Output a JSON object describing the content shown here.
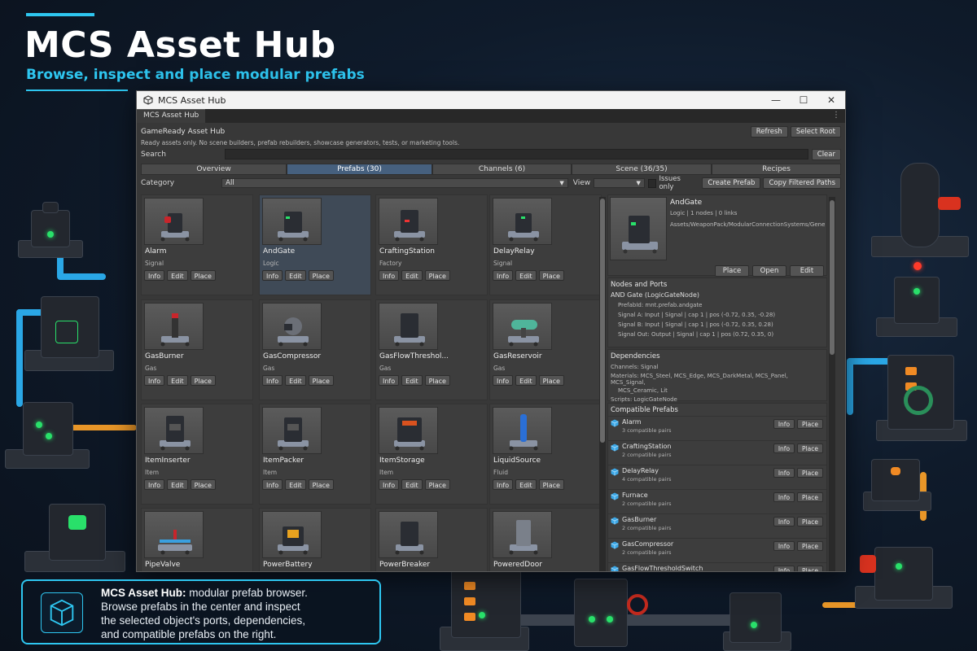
{
  "poster": {
    "title": "MCS Asset Hub",
    "subtitle": "Browse, inspect and place modular prefabs",
    "callout_bold": "MCS Asset Hub:",
    "callout_line1": " modular prefab browser.",
    "callout_line2": "Browse prefabs in the center and inspect",
    "callout_line3": "the selected object's ports, dependencies,",
    "callout_line4": "and compatible prefabs on the right."
  },
  "window": {
    "title": "MCS Asset Hub",
    "tab": "MCS Asset Hub",
    "minimize": "—",
    "maximize": "☐",
    "close": "✕"
  },
  "header": {
    "title": "GameReady Asset Hub",
    "refresh": "Refresh",
    "select_root": "Select Root",
    "note": "Ready assets only. No scene builders, prefab rebuilders, showcase generators, tests, or marketing tools."
  },
  "search": {
    "label": "Search",
    "value": "",
    "clear": "Clear"
  },
  "tabs": [
    "Overview",
    "Prefabs (30)",
    "Channels (6)",
    "Scene (36/35)",
    "Recipes"
  ],
  "filter": {
    "category_label": "Category",
    "category_value": "All",
    "view_label": "View",
    "view_value": "",
    "issues_only": "Issues only",
    "create_prefab": "Create Prefab",
    "copy_paths": "Copy Filtered Paths"
  },
  "card_actions": {
    "info": "Info",
    "edit": "Edit",
    "place": "Place"
  },
  "prefabs": [
    {
      "name": "Alarm",
      "category": "Signal"
    },
    {
      "name": "AndGate",
      "category": "Logic"
    },
    {
      "name": "CraftingStation",
      "category": "Factory"
    },
    {
      "name": "DelayRelay",
      "category": "Signal"
    },
    {
      "name": "GasBurner",
      "category": "Gas"
    },
    {
      "name": "GasCompressor",
      "category": "Gas"
    },
    {
      "name": "GasFlowThreshol...",
      "category": "Gas"
    },
    {
      "name": "GasReservoir",
      "category": "Gas"
    },
    {
      "name": "ItemInserter",
      "category": "Item"
    },
    {
      "name": "ItemPacker",
      "category": "Item"
    },
    {
      "name": "ItemStorage",
      "category": "Item"
    },
    {
      "name": "LiquidSource",
      "category": "Fluid"
    },
    {
      "name": "PipeValve",
      "category": ""
    },
    {
      "name": "PowerBattery",
      "category": ""
    },
    {
      "name": "PowerBreaker",
      "category": ""
    },
    {
      "name": "PoweredDoor",
      "category": ""
    }
  ],
  "detail": {
    "name": "AndGate",
    "meta": "Logic | 1 nodes | 0 links",
    "path": "Assets/WeaponPack/ModularConnectionSystems/Generated/Pr",
    "place": "Place",
    "open": "Open",
    "edit": "Edit"
  },
  "nodes": {
    "header": "Nodes and Ports",
    "node": "AND Gate (LogicGateNode)",
    "prefab_id": "PrefabId: mnt.prefab.andgate",
    "port_a": "Signal A: Input | Signal | cap 1 | pos (-0.72, 0.35, -0.28)",
    "port_b": "Signal B: Input | Signal | cap 1 | pos (-0.72, 0.35, 0.28)",
    "port_out": "Signal Out: Output | Signal | cap 1 | pos (0.72, 0.35, 0)"
  },
  "deps": {
    "header": "Dependencies",
    "channels": "Channels: Signal",
    "materials_1": "Materials: MCS_Steel, MCS_Edge, MCS_DarkMetal, MCS_Panel, MCS_Signal,",
    "materials_2": "MCS_Ceramic, Lit",
    "scripts": "Scripts: LogicGateNode"
  },
  "compatible": {
    "header": "Compatible Prefabs",
    "info": "Info",
    "place": "Place",
    "items": [
      {
        "name": "Alarm",
        "pairs": "3 compatible pairs"
      },
      {
        "name": "CraftingStation",
        "pairs": "2 compatible pairs"
      },
      {
        "name": "DelayRelay",
        "pairs": "4 compatible pairs"
      },
      {
        "name": "Furnace",
        "pairs": "2 compatible pairs"
      },
      {
        "name": "GasBurner",
        "pairs": "2 compatible pairs"
      },
      {
        "name": "GasCompressor",
        "pairs": "2 compatible pairs"
      },
      {
        "name": "GasFlowThresholdSwitch",
        "pairs": ""
      }
    ]
  },
  "colors": {
    "accent": "#2ec6f0",
    "active_tab": "#46607e",
    "selected_card": "#3f4a57",
    "led_green": "#29e06a",
    "led_red": "#ff3a2a"
  }
}
